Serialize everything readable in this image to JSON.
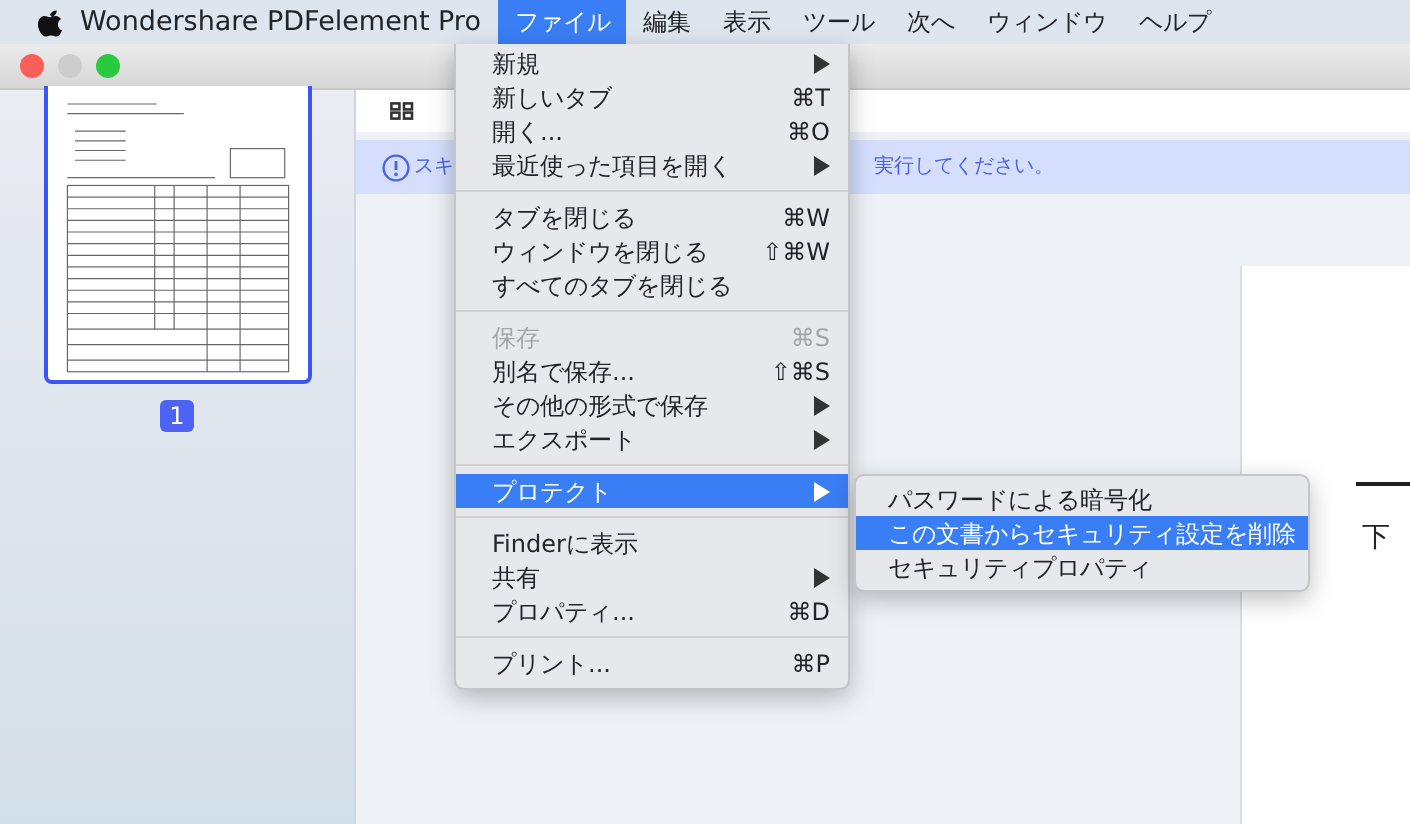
{
  "menubar": {
    "app_name": "Wondershare PDFelement Pro",
    "items": [
      {
        "label": "ファイル",
        "selected": true
      },
      {
        "label": "編集",
        "selected": false
      },
      {
        "label": "表示",
        "selected": false
      },
      {
        "label": "ツール",
        "selected": false
      },
      {
        "label": "次へ",
        "selected": false
      },
      {
        "label": "ウィンドウ",
        "selected": false
      },
      {
        "label": "ヘルプ",
        "selected": false
      }
    ]
  },
  "sidebar": {
    "page_badge": "1"
  },
  "banner": {
    "text_left": "スキ",
    "text_right": "実行してください。"
  },
  "document": {
    "text": "下"
  },
  "file_menu": {
    "items": [
      {
        "kind": "item",
        "label": "新規",
        "has_submenu": true,
        "disabled": false,
        "selected": false
      },
      {
        "kind": "item",
        "label": "新しいタブ",
        "shortcut": "⌘T",
        "disabled": false,
        "selected": false
      },
      {
        "kind": "item",
        "label": "開く...",
        "shortcut": "⌘O",
        "disabled": false,
        "selected": false
      },
      {
        "kind": "item",
        "label": "最近使った項目を開く",
        "has_submenu": true,
        "disabled": false,
        "selected": false
      },
      {
        "kind": "separator"
      },
      {
        "kind": "item",
        "label": "タブを閉じる",
        "shortcut": "⌘W",
        "disabled": false,
        "selected": false
      },
      {
        "kind": "item",
        "label": "ウィンドウを閉じる",
        "shortcut": "⇧⌘W",
        "disabled": false,
        "selected": false
      },
      {
        "kind": "item",
        "label": "すべてのタブを閉じる",
        "disabled": false,
        "selected": false
      },
      {
        "kind": "separator"
      },
      {
        "kind": "item",
        "label": "保存",
        "shortcut": "⌘S",
        "disabled": true,
        "selected": false
      },
      {
        "kind": "item",
        "label": "別名で保存...",
        "shortcut": "⇧⌘S",
        "disabled": false,
        "selected": false
      },
      {
        "kind": "item",
        "label": "その他の形式で保存",
        "has_submenu": true,
        "disabled": false,
        "selected": false
      },
      {
        "kind": "item",
        "label": "エクスポート",
        "has_submenu": true,
        "disabled": false,
        "selected": false
      },
      {
        "kind": "separator"
      },
      {
        "kind": "item",
        "label": "プロテクト",
        "has_submenu": true,
        "disabled": false,
        "selected": true
      },
      {
        "kind": "separator"
      },
      {
        "kind": "item",
        "label": "Finderに表示",
        "disabled": false,
        "selected": false
      },
      {
        "kind": "item",
        "label": "共有",
        "has_submenu": true,
        "disabled": false,
        "selected": false
      },
      {
        "kind": "item",
        "label": "プロパティ...",
        "shortcut": "⌘D",
        "disabled": false,
        "selected": false
      },
      {
        "kind": "separator"
      },
      {
        "kind": "item",
        "label": "プリント...",
        "shortcut": "⌘P",
        "disabled": false,
        "selected": false
      }
    ]
  },
  "protect_submenu": {
    "items": [
      {
        "label": "パスワードによる暗号化",
        "selected": false
      },
      {
        "label": "この文書からセキュリティ設定を削除",
        "selected": true
      },
      {
        "label": "セキュリティプロパティ",
        "selected": false
      }
    ]
  }
}
